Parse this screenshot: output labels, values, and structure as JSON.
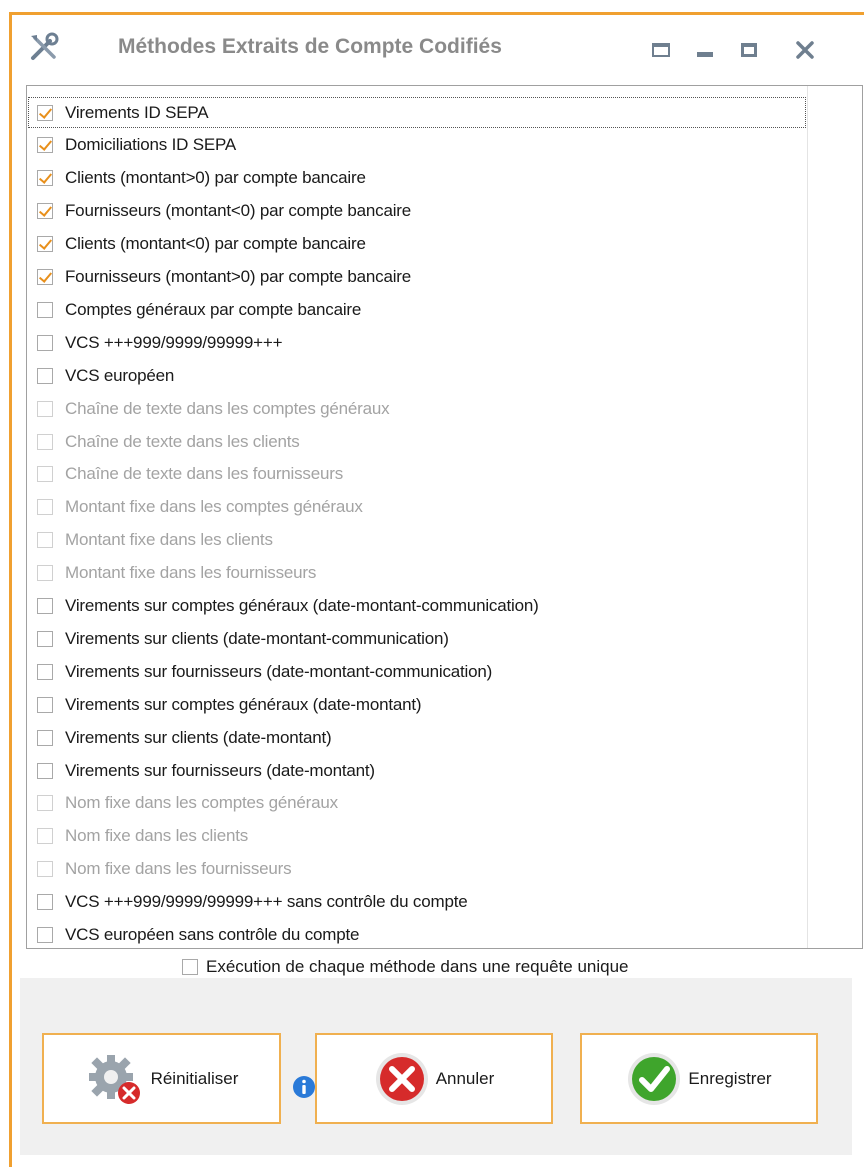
{
  "window": {
    "title": "Méthodes Extraits de Compte Codifiés",
    "icon": "tools-icon",
    "controls": [
      "pin-icon",
      "minimize-icon",
      "maximize-icon",
      "close-icon"
    ]
  },
  "methods": [
    {
      "label": "Virements ID SEPA",
      "checked": true,
      "enabled": true
    },
    {
      "label": "Domiciliations ID SEPA",
      "checked": true,
      "enabled": true
    },
    {
      "label": "Clients (montant>0) par compte bancaire",
      "checked": true,
      "enabled": true
    },
    {
      "label": "Fournisseurs (montant<0) par compte bancaire",
      "checked": true,
      "enabled": true
    },
    {
      "label": "Clients (montant<0) par compte bancaire",
      "checked": true,
      "enabled": true
    },
    {
      "label": "Fournisseurs (montant>0) par compte bancaire",
      "checked": true,
      "enabled": true
    },
    {
      "label": "Comptes généraux par compte bancaire",
      "checked": false,
      "enabled": true
    },
    {
      "label": "VCS +++999/9999/99999+++",
      "checked": false,
      "enabled": true
    },
    {
      "label": "VCS européen",
      "checked": false,
      "enabled": true
    },
    {
      "label": "Chaîne de texte dans les comptes généraux",
      "checked": false,
      "enabled": false
    },
    {
      "label": "Chaîne de texte dans les clients",
      "checked": false,
      "enabled": false
    },
    {
      "label": "Chaîne de texte dans les fournisseurs",
      "checked": false,
      "enabled": false
    },
    {
      "label": "Montant fixe dans les comptes généraux",
      "checked": false,
      "enabled": false
    },
    {
      "label": "Montant fixe dans les clients",
      "checked": false,
      "enabled": false
    },
    {
      "label": "Montant fixe dans les fournisseurs",
      "checked": false,
      "enabled": false
    },
    {
      "label": "Virements sur comptes généraux (date-montant-communication)",
      "checked": false,
      "enabled": true
    },
    {
      "label": "Virements sur clients (date-montant-communication)",
      "checked": false,
      "enabled": true
    },
    {
      "label": "Virements sur fournisseurs (date-montant-communication)",
      "checked": false,
      "enabled": true
    },
    {
      "label": "Virements sur comptes généraux (date-montant)",
      "checked": false,
      "enabled": true
    },
    {
      "label": "Virements sur clients (date-montant)",
      "checked": false,
      "enabled": true
    },
    {
      "label": "Virements sur fournisseurs (date-montant)",
      "checked": false,
      "enabled": true
    },
    {
      "label": "Nom fixe dans les comptes généraux",
      "checked": false,
      "enabled": false
    },
    {
      "label": "Nom fixe dans les clients",
      "checked": false,
      "enabled": false
    },
    {
      "label": "Nom fixe dans les fournisseurs",
      "checked": false,
      "enabled": false
    },
    {
      "label": "VCS +++999/9999/99999+++ sans contrôle du compte",
      "checked": false,
      "enabled": true
    },
    {
      "label": "VCS européen sans contrôle du compte",
      "checked": false,
      "enabled": true
    }
  ],
  "single_query_option": {
    "label": "Exécution de chaque méthode dans une requête unique",
    "checked": false
  },
  "buttons": {
    "reset": {
      "label": "Réinitialiser",
      "icon": "gear-error-icon"
    },
    "info": {
      "icon": "info-icon"
    },
    "cancel": {
      "label": "Annuler",
      "icon": "cancel-x-icon"
    },
    "save": {
      "label": "Enregistrer",
      "icon": "checkmark-icon"
    }
  },
  "colors": {
    "accent_border": "#f0a030",
    "checkmark": "#e8901c",
    "cancel_red": "#d62b2b",
    "save_green": "#3fa52c",
    "info_blue": "#2a7ad8"
  }
}
